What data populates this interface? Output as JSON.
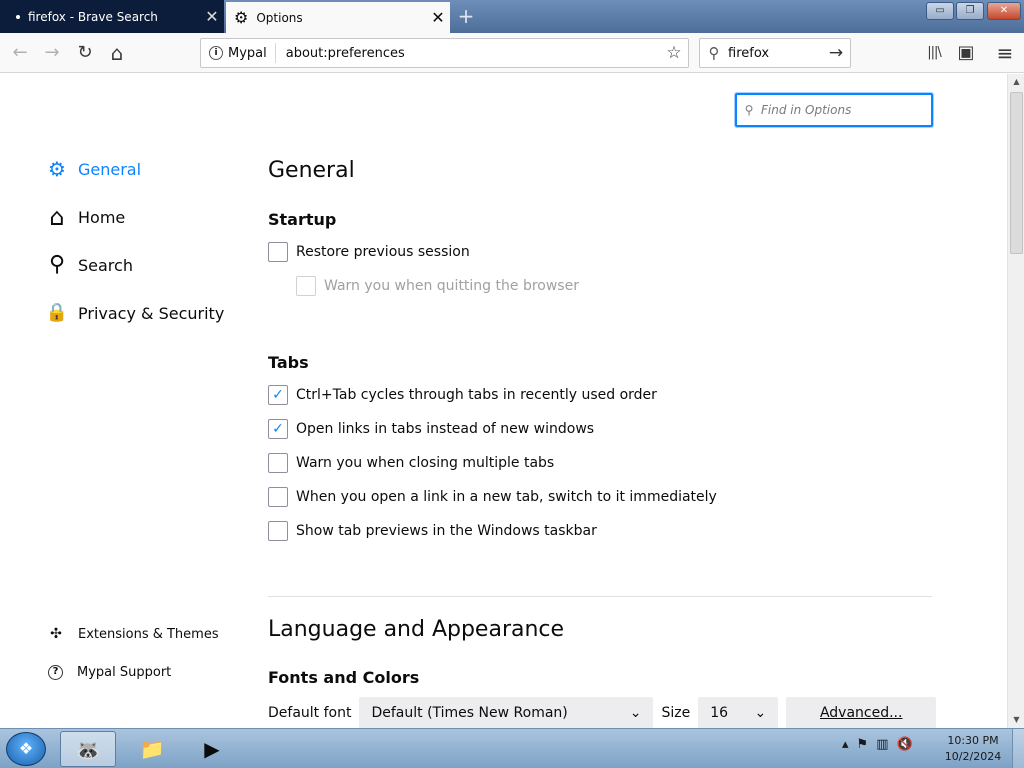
{
  "tabs": [
    {
      "title": "firefox - Brave Search",
      "close": "✕"
    },
    {
      "title": "Options",
      "close": "✕"
    }
  ],
  "newtab": "+",
  "window_controls": {
    "minimize": "▭",
    "maximize": "❐",
    "close": "✕"
  },
  "navbar": {
    "back_icon": "←",
    "forward_icon": "→",
    "reload_icon": "↻",
    "home_icon": "⌂",
    "identity_label": "Mypal",
    "url": "about:preferences",
    "bookmark_icon": "☆",
    "search_value": "firefox",
    "search_go_icon": "→",
    "library_icon": "|||\\",
    "sidebar_icon": "▣",
    "menu_icon": "≡"
  },
  "find": {
    "placeholder": "Find in Options"
  },
  "categories": [
    {
      "label": "General",
      "icon": "gear-icon",
      "glyph": "⚙"
    },
    {
      "label": "Home",
      "icon": "home-icon",
      "glyph": "⌂"
    },
    {
      "label": "Search",
      "icon": "search-icon",
      "glyph": "⚲"
    },
    {
      "label": "Privacy & Security",
      "icon": "lock-icon",
      "glyph": "🔒"
    }
  ],
  "footer_links": [
    {
      "label": "Extensions & Themes",
      "glyph": "✣"
    },
    {
      "label": "Mypal Support",
      "glyph": "?"
    }
  ],
  "main": {
    "heading": "General",
    "startup": {
      "heading": "Startup",
      "restore_session": {
        "label": "Restore previous session",
        "checked": false
      },
      "warn_quit": {
        "label": "Warn you when quitting the browser",
        "checked": false,
        "disabled": true
      }
    },
    "tabs": {
      "heading": "Tabs",
      "options": [
        {
          "label": "Ctrl+Tab cycles through tabs in recently used order",
          "checked": true
        },
        {
          "label": "Open links in tabs instead of new windows",
          "checked": true
        },
        {
          "label": "Warn you when closing multiple tabs",
          "checked": false
        },
        {
          "label": "When you open a link in a new tab, switch to it immediately",
          "checked": false
        },
        {
          "label": "Show tab previews in the Windows taskbar",
          "checked": false
        }
      ]
    },
    "language": {
      "heading": "Language and Appearance",
      "fonts_heading": "Fonts and Colors",
      "default_font_label": "Default font",
      "default_font_value": "Default (Times New Roman)",
      "size_label": "Size",
      "size_value": "16",
      "advanced_button": "Advanced..."
    }
  },
  "checkmark": "✓",
  "dropdown_arrow": "⌄",
  "taskbar": {
    "clock_time": "10:30 PM",
    "clock_date": "10/2/2024"
  },
  "colors": {
    "accent": "#0a84ff",
    "tab_dark": "#0b1d3a"
  }
}
